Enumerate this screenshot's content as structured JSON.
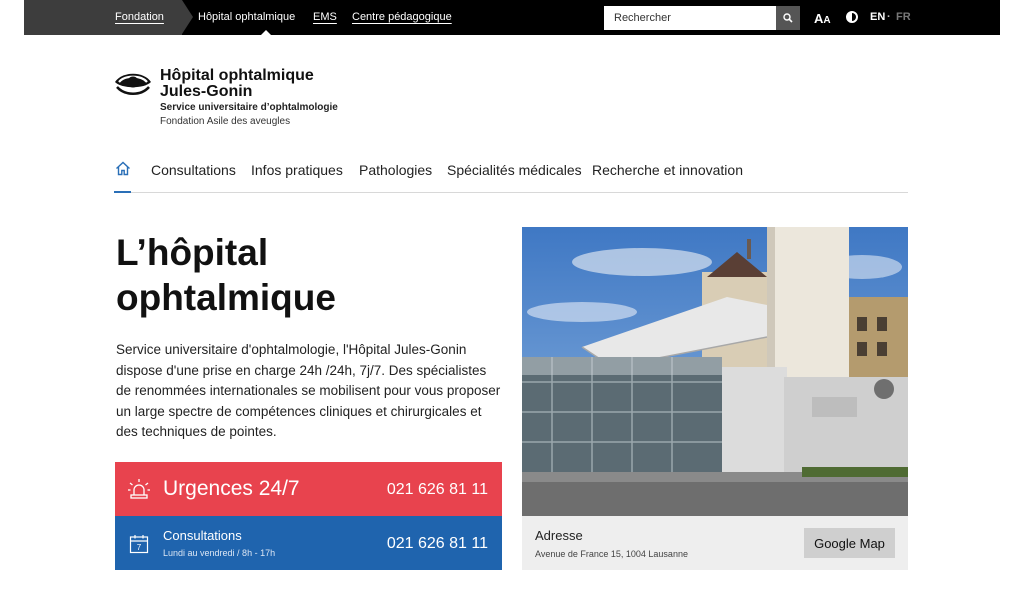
{
  "topbar": {
    "links": [
      "Fondation",
      "Hôpital ophtalmique",
      "EMS",
      "Centre pédagogique"
    ],
    "search_placeholder": "Rechercher",
    "font_size_toggle_big": "A",
    "font_size_toggle_small": "A",
    "lang_active": "EN",
    "lang_separator": "·",
    "lang_other": "FR"
  },
  "logo": {
    "title_line1": "Hôpital ophtalmique",
    "title_line2": "Jules-Gonin",
    "subtitle": "Service universitaire d’ophtalmologie",
    "subtitle2": "Fondation Asile des aveugles"
  },
  "mainnav": {
    "items": [
      "Consultations",
      "Infos pratiques",
      "Pathologies",
      "Spécialités médicales",
      "Recherche et innovation"
    ]
  },
  "hero": {
    "title_line1": "L’hôpital",
    "title_line2": "ophtalmique",
    "text": "Service universitaire d'ophtalmologie, l'Hôpital Jules-Gonin dispose d'une prise en charge 24h /24h, 7j/7. Des spécialistes de renommées internationales se mobilisent pour vous proposer un large spectre de compétences cliniques et chirurgicales et des techniques de pointes."
  },
  "emergency": {
    "label": "Urgences 24/7",
    "phone": "021 626 81 11",
    "color": "#e8434e"
  },
  "consultations": {
    "label": "Consultations",
    "hours": "Lundi au vendredi / 8h - 17h",
    "phone": "021 626 81 11",
    "calendar_day": "7",
    "color": "#1f64ae"
  },
  "address": {
    "label": "Adresse",
    "value": "Avenue de France 15, 1004 Lausanne",
    "button": "Google Map"
  }
}
